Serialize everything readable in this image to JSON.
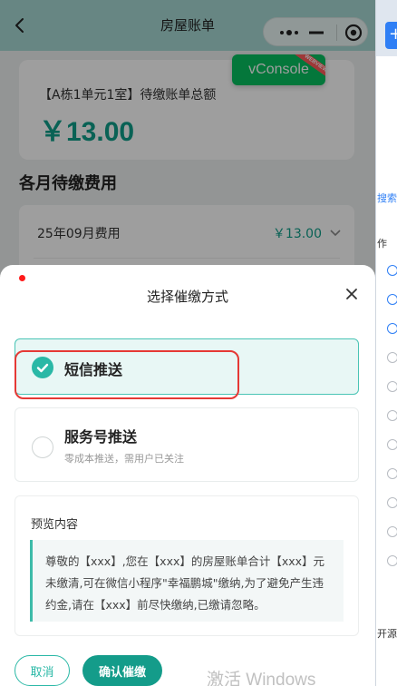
{
  "navbar": {
    "title": "房屋账单"
  },
  "summary": {
    "label": "【A栋1单元1室】待缴账单总额",
    "amount": "￥13.00"
  },
  "monthly": {
    "section_title": "各月待缴费用",
    "items": [
      {
        "label": "25年09月费用",
        "amount": "￥13.00"
      }
    ]
  },
  "vconsole": {
    "label": "vConsole",
    "ribbon": "WEBVIEW"
  },
  "sheet": {
    "title": "选择催缴方式",
    "options": [
      {
        "title": "短信推送",
        "selected": true
      },
      {
        "title": "服务号推送",
        "desc": "零成本推送，需用户已关注",
        "selected": false
      }
    ],
    "preview": {
      "label": "预览内容",
      "text": "尊敬的【xxx】,您在【xxx】的房屋账单合计【xxx】元未缴清,可在微信小程序\"幸福鹏城\"缴纳,为了避免产生违约金,请在【xxx】前尽快缴纳,已缴请忽略。"
    },
    "buttons": {
      "cancel": "取消",
      "confirm": "确认催缴"
    }
  },
  "watermark": "激活 Windows",
  "background_window": {
    "items": [
      "搜索",
      "作",
      "开源"
    ]
  },
  "colors": {
    "accent": "#2ab8a6",
    "confirm": "#149c8a",
    "navbar": "#a7d8d4",
    "annotation": "#e53935"
  }
}
